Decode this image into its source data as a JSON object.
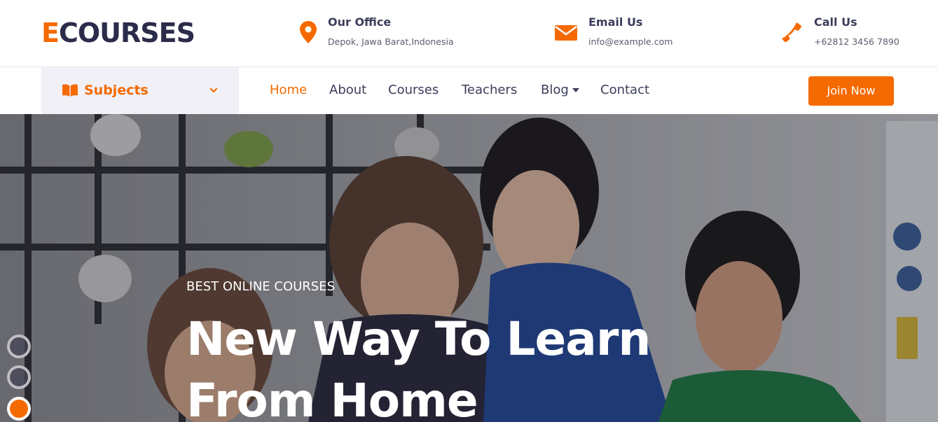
{
  "brand": {
    "logo_accent": "E",
    "logo_rest": "COURSES"
  },
  "colors": {
    "accent": "#f56a00",
    "navy": "#2b2c4a",
    "text": "#3b3d5a"
  },
  "contact": {
    "office": {
      "title": "Our Office",
      "text": "Depok, Jawa Barat,Indonesia",
      "icon": "map-pin-icon"
    },
    "email": {
      "title": "Email Us",
      "text": "info@example.com",
      "icon": "envelope-icon"
    },
    "call": {
      "title": "Call Us",
      "text": "+62812 3456 7890",
      "icon": "phone-icon"
    }
  },
  "nav": {
    "subjects_label": "Subjects",
    "subjects_icon": "book-icon",
    "items": [
      "Home",
      "About",
      "Courses",
      "Teachers",
      "Blog",
      "Contact"
    ],
    "active": "Home",
    "join_label": "Join Now"
  },
  "hero": {
    "kicker": "BEST ONLINE COURSES",
    "title_line1": "New Way To Learn",
    "title_line2": "From Home",
    "slide_count": 3,
    "active_slide": 3
  }
}
